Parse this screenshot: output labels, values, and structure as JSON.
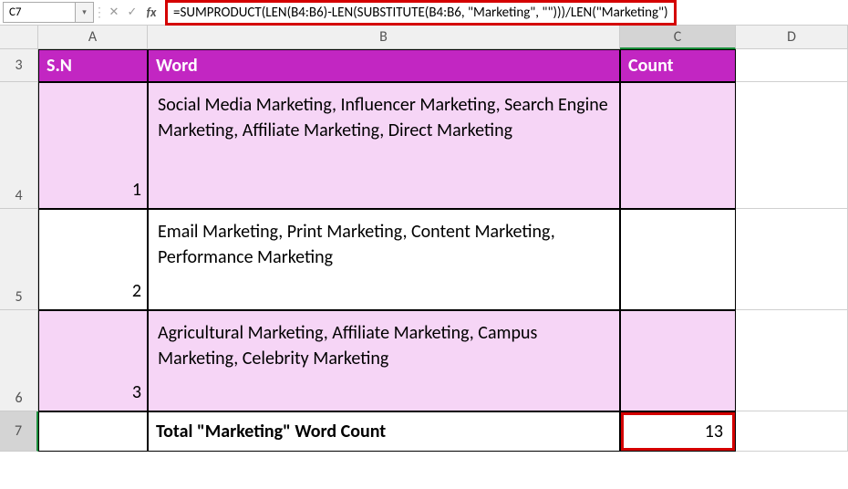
{
  "nameBox": "C7",
  "formula": "=SUMPRODUCT(LEN(B4:B6)-LEN(SUBSTITUTE(B4:B6, \"Marketing\", \"\")))/LEN(\"Marketing\")",
  "cancelGlyph": "✕",
  "confirmGlyph": "✓",
  "fxLabel": "fx",
  "ddGlyph": "▾",
  "sepGlyph": "⋮",
  "columns": {
    "A": "A",
    "B": "B",
    "C": "C",
    "D": "D"
  },
  "rowLabels": {
    "r3": "3",
    "r4": "4",
    "r5": "5",
    "r6": "6",
    "r7": "7"
  },
  "headers": {
    "sn": "S.N",
    "word": "Word",
    "count": "Count"
  },
  "rows": [
    {
      "sn": "1",
      "word": "Social Media Marketing, Influencer Marketing, Search Engine Marketing, Affiliate Marketing, Direct Marketing",
      "count": ""
    },
    {
      "sn": "2",
      "word": " Email Marketing, Print Marketing, Content Marketing, Performance Marketing",
      "count": ""
    },
    {
      "sn": "3",
      "word": "Agricultural Marketing, Affiliate Marketing, Campus Marketing, Celebrity Marketing",
      "count": ""
    }
  ],
  "total": {
    "label": "Total \"Marketing\" Word Count",
    "value": "13"
  }
}
